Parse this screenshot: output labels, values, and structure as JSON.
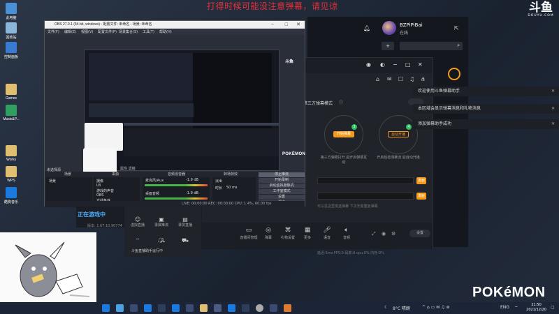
{
  "banner": "打得时候可能没注意弹幕，请见谅",
  "desktop_icons": [
    {
      "label": "此电脑",
      "color": "#4a90d9",
      "icon": "computer-icon"
    },
    {
      "label": "回收站",
      "color": "#8ab4d8",
      "icon": "recycle-bin-icon"
    },
    {
      "label": "控制面板",
      "color": "#3a7ad0",
      "icon": "control-panel-icon"
    },
    {
      "label": "Games",
      "color": "#e0c070",
      "icon": "folder-icon"
    },
    {
      "label": "Music&P...",
      "color": "#30a060",
      "icon": "folder-icon"
    },
    {
      "label": "Works",
      "color": "#e0c070",
      "icon": "folder-icon"
    },
    {
      "label": "WPS",
      "color": "#e0c070",
      "icon": "folder-icon"
    },
    {
      "label": "酷狗音乐",
      "color": "#1a7ae0",
      "icon": "kugou-icon"
    }
  ],
  "douyu": {
    "logo": "斗鱼",
    "sub": "DOUYU.COM"
  },
  "user": {
    "name": "BZPiPiBai",
    "status": "在线"
  },
  "assistant": {
    "mode_text": "第三方弹幕模式",
    "circles": [
      {
        "pill": "开始弹幕",
        "num": "3",
        "caption": "第三方弹幕打开\n后开启弹幕互动"
      },
      {
        "pill": "自动开播",
        "num": "4",
        "caption": "开启后检测推流\n后自动开播"
      }
    ],
    "send": "发射",
    "tip": "可以在这里发送弹幕   下次无需重复弹幕",
    "bottom": [
      {
        "label": "直播间管理",
        "icon": "monitor-icon"
      },
      {
        "label": "弹幕",
        "icon": "chat-icon"
      },
      {
        "label": "礼物设置",
        "icon": "gift-icon"
      },
      {
        "label": "更多",
        "icon": "more-icon"
      },
      {
        "label": "语音",
        "icon": "mic-icon"
      },
      {
        "label": "音频",
        "icon": "speaker-icon"
      }
    ],
    "settings_pill": "设置",
    "status": "延迟:5ms   FPS:0   码率:0   cpu:0%   内存:0%"
  },
  "notifications": [
    "欢迎使用斗鱼弹幕助手",
    "本区域会显示弹幕消息和礼物消息",
    "添加弹幕助手成功"
  ],
  "obs": {
    "title": "OBS 27.0.1 (64-bit, windows) - 配置文件: 未命名 - 场景: 未命名",
    "menu": [
      "文件(F)",
      "编辑(E)",
      "视图(V)",
      "配置文件(P)",
      "场景集合(S)",
      "工具(T)",
      "帮助(H)"
    ],
    "cur_scene_label": "未选择源",
    "props": "属性   滤镜",
    "docks": {
      "scenes": "场景",
      "sources": "来源",
      "mixer": "音频混音器",
      "transitions": "转场特效",
      "controls": "控件"
    },
    "scene_item": "场景",
    "sources_list": [
      "摄像",
      "LB",
      "游戏的声音",
      "OBS",
      "光线条件",
      "斗鱼"
    ],
    "mixer": [
      {
        "name": "麦克风/Aux",
        "value": "-1.9 dB"
      },
      {
        "name": "桌面音频",
        "value": "-1.9 dB"
      }
    ],
    "transition": "淡出",
    "duration_label": "时长",
    "duration_value": "50 ms",
    "controls": [
      "停止推流",
      "开始录制",
      "启动虚拟摄像机",
      "工作室模式",
      "设置",
      "退出"
    ],
    "status": "LIVE: 00:00:00   REC: 00:00:00   CPU: 1.4%, 60.00 fps",
    "preview_logo": "POKÉMON",
    "preview_douyu": "斗鱼"
  },
  "game": {
    "live": "正在游戏中",
    "version": "版本: 1.67.10.90774"
  },
  "tools": {
    "buttons": [
      {
        "label": "虚拟直播",
        "icon": "face-icon"
      },
      {
        "label": "录屏推流",
        "icon": "screen-icon"
      },
      {
        "label": "录屏直播",
        "icon": "record-icon"
      },
      {
        "label": "",
        "icon": "wifi-icon"
      },
      {
        "label": "",
        "icon": "tent-icon"
      },
      {
        "label": "",
        "icon": "car-icon"
      }
    ],
    "footer": "斗鱼直播助手运行中"
  },
  "pokemon": "POKéMON",
  "taskbar": {
    "weather": "8°C 晴朗",
    "lang": "ENG",
    "time": "21:50",
    "date": "2021/12/20"
  }
}
